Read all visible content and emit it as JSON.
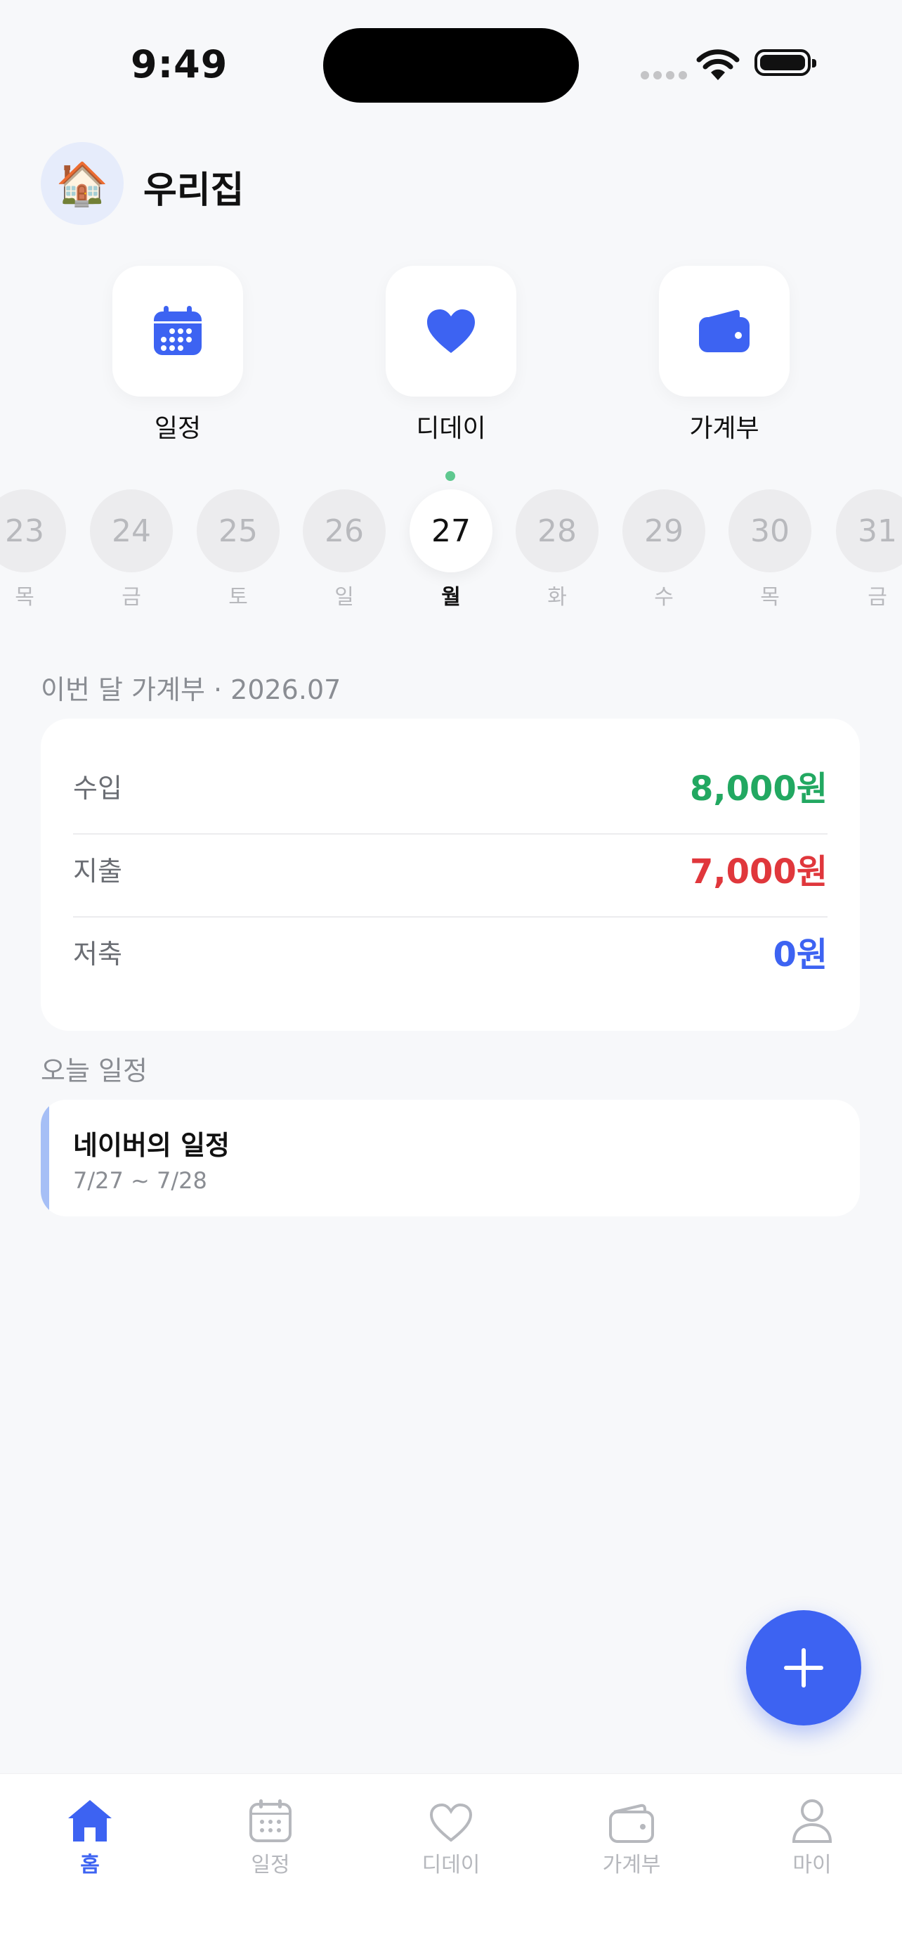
{
  "status": {
    "time": "9:49"
  },
  "header": {
    "family_name": "우리집",
    "avatar_emoji": "🏠"
  },
  "quick": [
    {
      "label": "일정",
      "icon": "calendar-icon"
    },
    {
      "label": "디데이",
      "icon": "heart-icon"
    },
    {
      "label": "가계부",
      "icon": "wallet-icon"
    }
  ],
  "days": [
    {
      "n": "23",
      "w": "목"
    },
    {
      "n": "24",
      "w": "금"
    },
    {
      "n": "25",
      "w": "토"
    },
    {
      "n": "26",
      "w": "일"
    },
    {
      "n": "27",
      "w": "월"
    },
    {
      "n": "28",
      "w": "화"
    },
    {
      "n": "29",
      "w": "수"
    },
    {
      "n": "30",
      "w": "목"
    },
    {
      "n": "31",
      "w": "금"
    }
  ],
  "budget": {
    "title": "이번 달 가계부 · 2026.07",
    "income_label": "수입",
    "income_value": "8,000원",
    "expense_label": "지출",
    "expense_value": "7,000원",
    "saving_label": "저축",
    "saving_value": "0원"
  },
  "today": {
    "title": "오늘 일정",
    "items": [
      {
        "name": "네이버의 일정",
        "range": "7/27 ~ 7/28"
      }
    ]
  },
  "colors": {
    "accent": "#3d63f2",
    "income": "#22a861",
    "expense": "#e0373c",
    "saving": "#3d63f2"
  },
  "tabs": [
    {
      "label": "홈",
      "icon": "home-icon"
    },
    {
      "label": "일정",
      "icon": "calendar-icon"
    },
    {
      "label": "디데이",
      "icon": "heart-icon"
    },
    {
      "label": "가계부",
      "icon": "wallet-icon"
    },
    {
      "label": "마이",
      "icon": "person-icon"
    }
  ]
}
